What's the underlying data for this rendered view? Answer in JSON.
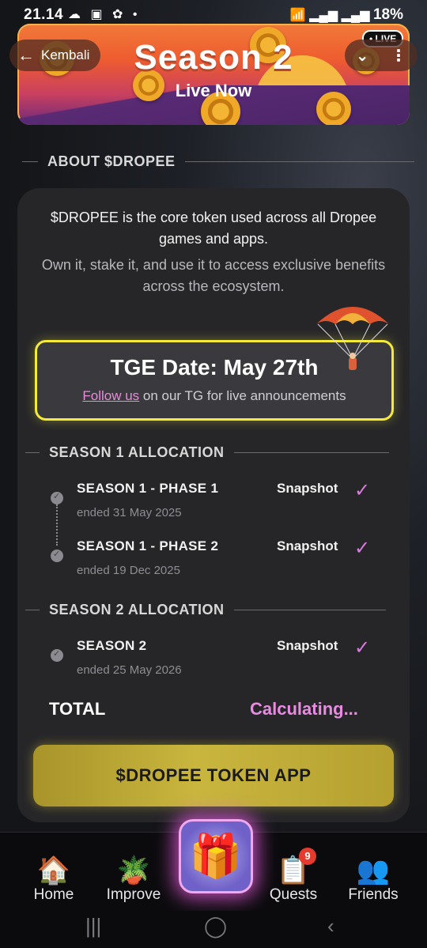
{
  "status_bar": {
    "time": "21.14",
    "notif_icons": "☁ ▣ ✿ •",
    "battery": "18%"
  },
  "banner": {
    "title": "Season 2",
    "subtitle": "Live Now",
    "live_badge": "• LIVE"
  },
  "header": {
    "back_label": "Kembali",
    "chevron_icon": "chevron-down-icon",
    "menu_icon": "more-vertical-icon"
  },
  "about": {
    "heading": "ABOUT $DROPEE",
    "intro_primary": "$DROPEE is the core token used across all Dropee games and apps.",
    "intro_secondary": "Own it, stake it, and use it to access exclusive benefits across the ecosystem."
  },
  "tge": {
    "date_text": "TGE Date: May 27th",
    "follow_link": "Follow us",
    "follow_rest": " on our TG for live announcements"
  },
  "season1": {
    "heading": "SEASON 1 ALLOCATION",
    "rows": [
      {
        "label": "SEASON 1 - PHASE 1",
        "date": "ended 31 May 2025",
        "status": "Snapshot"
      },
      {
        "label": "SEASON 1 - PHASE 2",
        "date": "ended 19 Dec 2025",
        "status": "Snapshot"
      }
    ]
  },
  "season2": {
    "heading": "SEASON 2 ALLOCATION",
    "rows": [
      {
        "label": "SEASON 2",
        "date": "ended 25 May 2026",
        "status": "Snapshot"
      }
    ]
  },
  "total": {
    "label": "TOTAL",
    "value": "Calculating..."
  },
  "token_app_button": "$DROPEE TOKEN APP",
  "bottom_nav": {
    "items": [
      {
        "label": "Home",
        "icon": "home-icon"
      },
      {
        "label": "Improve",
        "icon": "sprout-icon"
      },
      {
        "label": "Quests",
        "icon": "quests-icon",
        "badge": "9"
      },
      {
        "label": "Friends",
        "icon": "friends-icon"
      }
    ],
    "center_icon": "gift-icon"
  },
  "colors": {
    "accent_yellow": "#f5ea3a",
    "accent_pink": "#e98be3",
    "button_gold": "#c9b63e"
  }
}
